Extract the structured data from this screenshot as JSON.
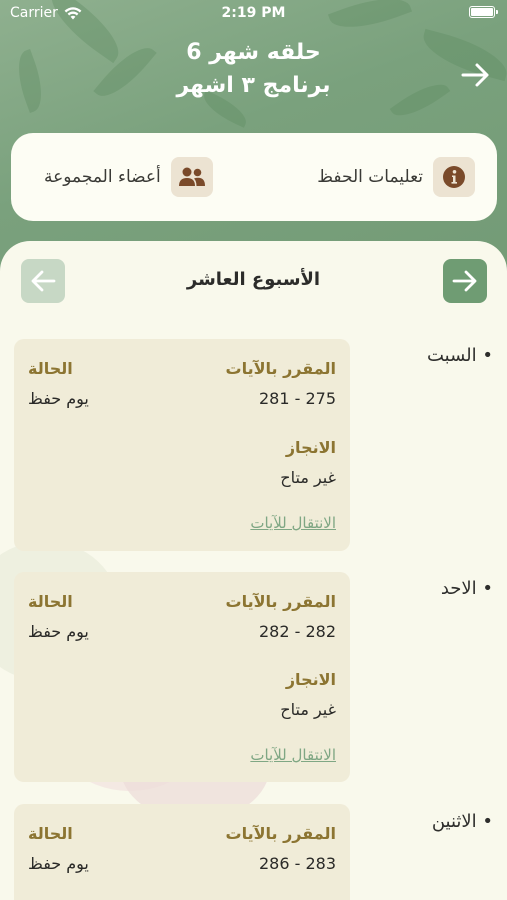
{
  "status_bar": {
    "carrier": "Carrier",
    "time": "2:19 PM"
  },
  "header": {
    "title_line1": "حلقه شهر 6",
    "title_line2": "برنامج ٣ اشهر"
  },
  "top_card": {
    "instructions_label": "تعليمات الحفظ",
    "members_label": "أعضاء المجموعة"
  },
  "week": {
    "title": "الأسبوع العاشر"
  },
  "days": [
    {
      "day": "• السبت",
      "assigned_label": "المقرر بالآيات",
      "assigned_value": "275 - 281",
      "status_label": "الحالة",
      "status_value": "يوم حفظ",
      "achievement_label": "الانجاز",
      "achievement_value": "غير متاح",
      "link": "الانتقال للآيات"
    },
    {
      "day": "• الاحد",
      "assigned_label": "المقرر بالآيات",
      "assigned_value": "282 - 282",
      "status_label": "الحالة",
      "status_value": "يوم حفظ",
      "achievement_label": "الانجاز",
      "achievement_value": "غير متاح",
      "link": "الانتقال للآيات"
    },
    {
      "day": "• الاثنين",
      "assigned_label": "المقرر بالآيات",
      "assigned_value": "283 - 286",
      "status_label": "الحالة",
      "status_value": "يوم حفظ"
    }
  ],
  "colors": {
    "header_green": "#7aa17d",
    "accent_green": "#6f9c73",
    "gold_label": "#8c7532",
    "card_bg": "#f0ecd8",
    "icon_brown": "#7a4a2a"
  },
  "icons": [
    "wifi-icon",
    "battery-icon",
    "arrow-right-icon",
    "info-icon",
    "group-icon",
    "arrow-left-icon"
  ]
}
